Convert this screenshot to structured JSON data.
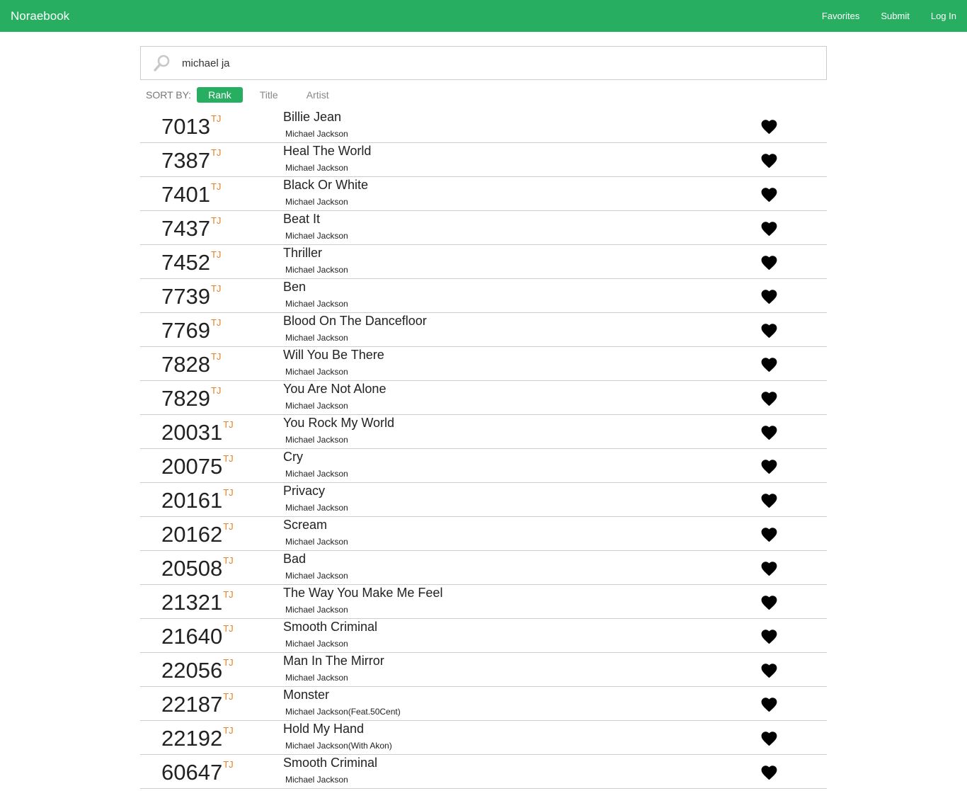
{
  "navbar": {
    "brand": "Noraebook",
    "links": [
      "Favorites",
      "Submit",
      "Log In"
    ]
  },
  "search": {
    "value": "michael ja"
  },
  "sort": {
    "label": "SORT BY:",
    "options": [
      "Rank",
      "Title",
      "Artist"
    ],
    "active": "Rank"
  },
  "colors": {
    "brand_green": "#27ae60",
    "tag_orange": "#e67e22"
  },
  "songs": [
    {
      "number": "7013",
      "tag": "TJ",
      "title": "Billie Jean",
      "artist": "Michael Jackson"
    },
    {
      "number": "7387",
      "tag": "TJ",
      "title": "Heal The World",
      "artist": "Michael Jackson"
    },
    {
      "number": "7401",
      "tag": "TJ",
      "title": "Black Or White",
      "artist": "Michael Jackson"
    },
    {
      "number": "7437",
      "tag": "TJ",
      "title": "Beat It",
      "artist": "Michael Jackson"
    },
    {
      "number": "7452",
      "tag": "TJ",
      "title": "Thriller",
      "artist": "Michael Jackson"
    },
    {
      "number": "7739",
      "tag": "TJ",
      "title": "Ben",
      "artist": "Michael Jackson"
    },
    {
      "number": "7769",
      "tag": "TJ",
      "title": "Blood On The Dancefloor",
      "artist": "Michael Jackson"
    },
    {
      "number": "7828",
      "tag": "TJ",
      "title": "Will You Be There",
      "artist": "Michael Jackson"
    },
    {
      "number": "7829",
      "tag": "TJ",
      "title": "You Are Not Alone",
      "artist": "Michael Jackson"
    },
    {
      "number": "20031",
      "tag": "TJ",
      "title": "You Rock My World",
      "artist": "Michael Jackson"
    },
    {
      "number": "20075",
      "tag": "TJ",
      "title": "Cry",
      "artist": "Michael Jackson"
    },
    {
      "number": "20161",
      "tag": "TJ",
      "title": "Privacy",
      "artist": "Michael Jackson"
    },
    {
      "number": "20162",
      "tag": "TJ",
      "title": "Scream",
      "artist": "Michael Jackson"
    },
    {
      "number": "20508",
      "tag": "TJ",
      "title": "Bad",
      "artist": "Michael Jackson"
    },
    {
      "number": "21321",
      "tag": "TJ",
      "title": "The Way You Make Me Feel",
      "artist": "Michael Jackson"
    },
    {
      "number": "21640",
      "tag": "TJ",
      "title": "Smooth Criminal",
      "artist": "Michael Jackson"
    },
    {
      "number": "22056",
      "tag": "TJ",
      "title": "Man In The Mirror",
      "artist": "Michael Jackson"
    },
    {
      "number": "22187",
      "tag": "TJ",
      "title": "Monster",
      "artist": "Michael Jackson(Feat.50Cent)"
    },
    {
      "number": "22192",
      "tag": "TJ",
      "title": "Hold My Hand",
      "artist": "Michael Jackson(With Akon)"
    },
    {
      "number": "60647",
      "tag": "TJ",
      "title": "Smooth Criminal",
      "artist": "Michael Jackson"
    }
  ]
}
